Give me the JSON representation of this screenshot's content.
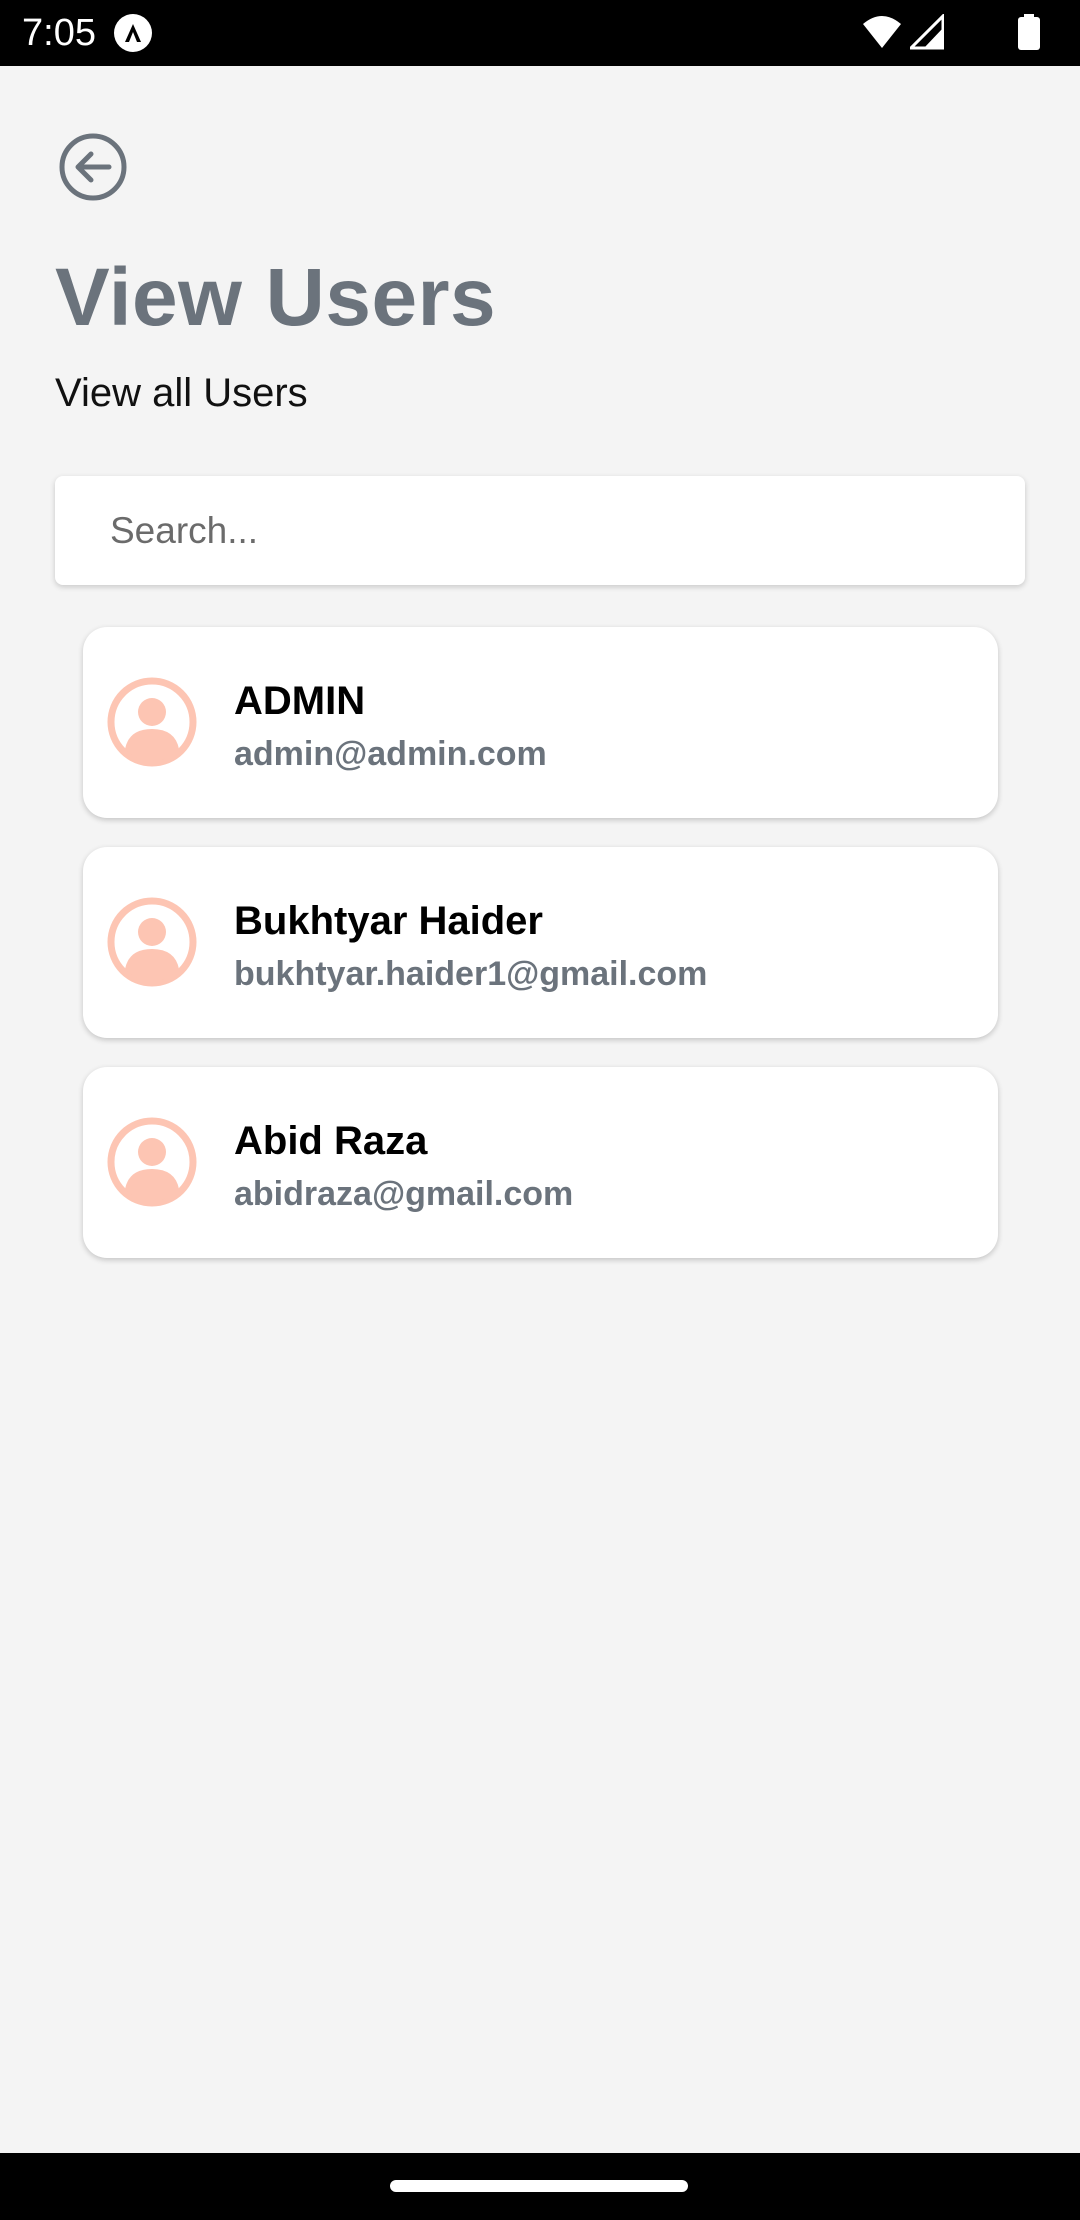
{
  "status_bar": {
    "time": "7:05",
    "icons": [
      "app-notification-icon",
      "wifi-icon",
      "signal-icon",
      "battery-icon"
    ]
  },
  "header": {
    "back_icon": "arrow-left-circle-icon",
    "title": "View Users",
    "subtitle": "View all Users"
  },
  "search": {
    "placeholder": "Search...",
    "value": ""
  },
  "users": [
    {
      "name": "ADMIN",
      "email": "admin@admin.com"
    },
    {
      "name": "Bukhtyar Haider",
      "email": "bukhtyar.haider1@gmail.com"
    },
    {
      "name": "Abid Raza",
      "email": "abidraza@gmail.com"
    }
  ],
  "colors": {
    "title": "#6b737c",
    "avatar": "#fdc5b3",
    "background": "#f4f4f4"
  }
}
